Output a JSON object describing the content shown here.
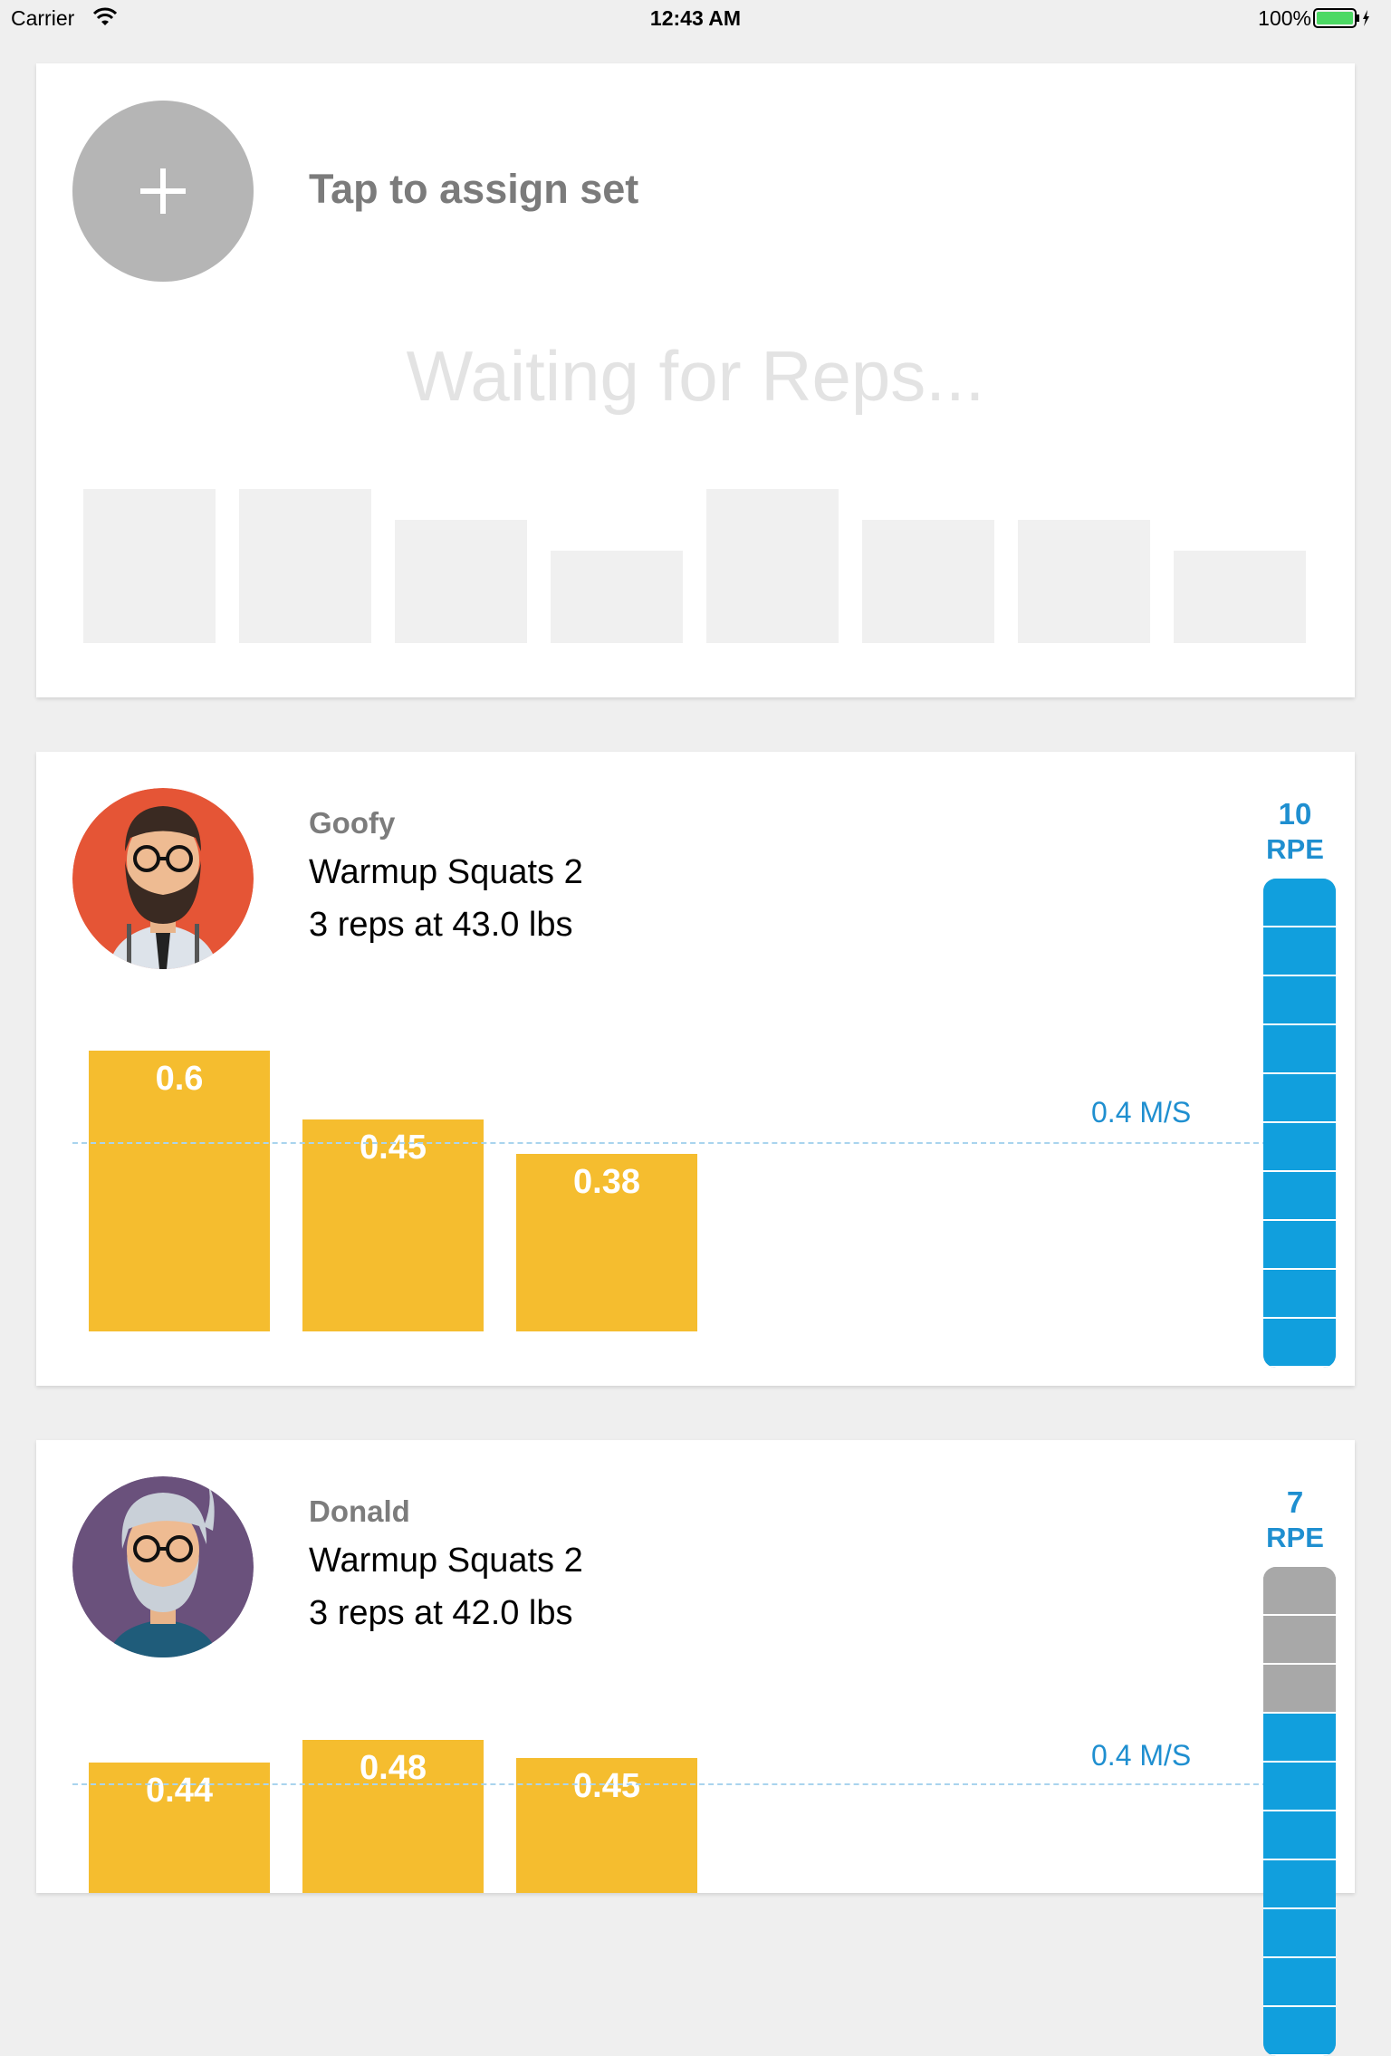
{
  "status_bar": {
    "carrier": "Carrier",
    "time": "12:43 AM",
    "battery": "100%",
    "icons": [
      "wifi-icon",
      "battery-icon",
      "charging-icon"
    ]
  },
  "assign_card": {
    "add_icon": "plus-icon",
    "label": "Tap to assign set",
    "waiting": "Waiting for Reps..."
  },
  "athletes": [
    {
      "name": "Goofy",
      "set_name": "Warmup Squats 2",
      "reps_summary": "3 reps at 43.0 lbs",
      "threshold_label": "0.4 M/S",
      "rpe_value": "10",
      "rpe_unit": "RPE",
      "rpe_level": 10,
      "rpe_max": 10,
      "rep_velocities": [
        "0.6",
        "0.45",
        "0.38"
      ]
    },
    {
      "name": "Donald",
      "set_name": "Warmup Squats 2",
      "reps_summary": "3 reps at 42.0 lbs",
      "threshold_label": "0.4 M/S",
      "rpe_value": "7",
      "rpe_unit": "RPE",
      "rpe_level": 7,
      "rpe_max": 10,
      "rep_velocities": [
        "0.44",
        "0.48",
        "0.45"
      ]
    }
  ],
  "colors": {
    "accent": "#1f8fd0",
    "bar": "#f5bd2f",
    "gauge_active": "#119fdd",
    "gauge_inactive": "#a8a8a8"
  }
}
